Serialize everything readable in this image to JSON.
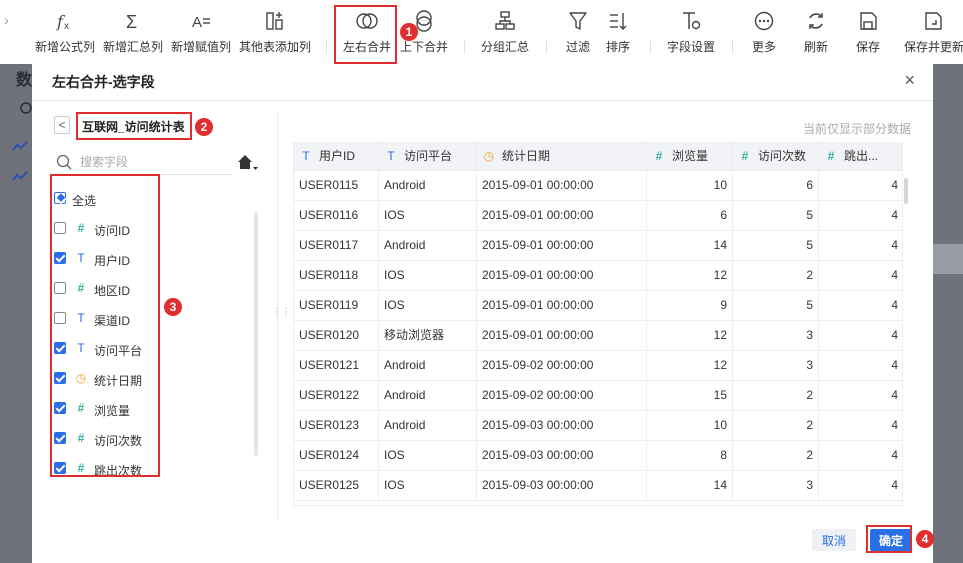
{
  "toolbar": {
    "items": [
      {
        "label": "新增公式列",
        "icon": "formula-icon"
      },
      {
        "label": "新增汇总列",
        "icon": "sigma-icon"
      },
      {
        "label": "新增赋值列",
        "icon": "assign-icon"
      },
      {
        "label": "其他表添加列",
        "icon": "add-column-icon"
      },
      {
        "label": "左右合并",
        "icon": "merge-horizontal-icon"
      },
      {
        "label": "上下合并",
        "icon": "merge-vertical-icon"
      },
      {
        "label": "分组汇总",
        "icon": "group-icon"
      },
      {
        "label": "过滤",
        "icon": "filter-icon"
      },
      {
        "label": "排序",
        "icon": "sort-icon"
      },
      {
        "label": "字段设置",
        "icon": "field-settings-icon"
      },
      {
        "label": "更多",
        "icon": "more-icon"
      },
      {
        "label": "刷新",
        "icon": "refresh-icon"
      },
      {
        "label": "保存",
        "icon": "save-icon"
      },
      {
        "label": "保存并更新",
        "icon": "save-update-icon"
      }
    ]
  },
  "annotations": [
    "1",
    "2",
    "3",
    "4"
  ],
  "background": {
    "title_char": "数"
  },
  "modal": {
    "title": "左右合并-选字段",
    "close": "×",
    "back": "<",
    "table_name": "互联网_访问统计表",
    "search_placeholder": "搜索字段",
    "select_all": "全选",
    "fields": [
      {
        "name": "访问ID",
        "type": "num",
        "checked": false
      },
      {
        "name": "用户ID",
        "type": "text",
        "checked": true
      },
      {
        "name": "地区ID",
        "type": "num",
        "checked": false
      },
      {
        "name": "渠道ID",
        "type": "text",
        "checked": false
      },
      {
        "name": "访问平台",
        "type": "text",
        "checked": true
      },
      {
        "name": "统计日期",
        "type": "date",
        "checked": true
      },
      {
        "name": "浏览量",
        "type": "num",
        "checked": true
      },
      {
        "name": "访问次数",
        "type": "num",
        "checked": true
      },
      {
        "name": "跳出次数",
        "type": "num",
        "checked": true
      }
    ],
    "preview_note": "当前仅显示部分数据",
    "columns": [
      {
        "label": "用户ID",
        "type": "text"
      },
      {
        "label": "访问平台",
        "type": "text"
      },
      {
        "label": "统计日期",
        "type": "date"
      },
      {
        "label": "浏览量",
        "type": "num"
      },
      {
        "label": "访问次数",
        "type": "num"
      },
      {
        "label": "跳出...",
        "type": "num"
      }
    ],
    "rows": [
      [
        "USER0115",
        "Android",
        "2015-09-01 00:00:00",
        "10",
        "6",
        "4"
      ],
      [
        "USER0116",
        "IOS",
        "2015-09-01 00:00:00",
        "6",
        "5",
        "4"
      ],
      [
        "USER0117",
        "Android",
        "2015-09-01 00:00:00",
        "14",
        "5",
        "4"
      ],
      [
        "USER0118",
        "IOS",
        "2015-09-01 00:00:00",
        "12",
        "2",
        "4"
      ],
      [
        "USER0119",
        "IOS",
        "2015-09-01 00:00:00",
        "9",
        "5",
        "4"
      ],
      [
        "USER0120",
        "移动浏览器",
        "2015-09-01 00:00:00",
        "12",
        "3",
        "4"
      ],
      [
        "USER0121",
        "Android",
        "2015-09-02 00:00:00",
        "12",
        "3",
        "4"
      ],
      [
        "USER0122",
        "Android",
        "2015-09-02 00:00:00",
        "15",
        "2",
        "4"
      ],
      [
        "USER0123",
        "Android",
        "2015-09-03 00:00:00",
        "10",
        "2",
        "4"
      ],
      [
        "USER0124",
        "IOS",
        "2015-09-03 00:00:00",
        "8",
        "2",
        "4"
      ],
      [
        "USER0125",
        "IOS",
        "2015-09-03 00:00:00",
        "14",
        "3",
        "4"
      ]
    ],
    "cancel": "取消",
    "confirm": "确定"
  },
  "colors": {
    "accent": "#2a6ee8",
    "annotation": "#e02d2d",
    "number_type": "#34b3a0",
    "date_type": "#f0a12a"
  }
}
